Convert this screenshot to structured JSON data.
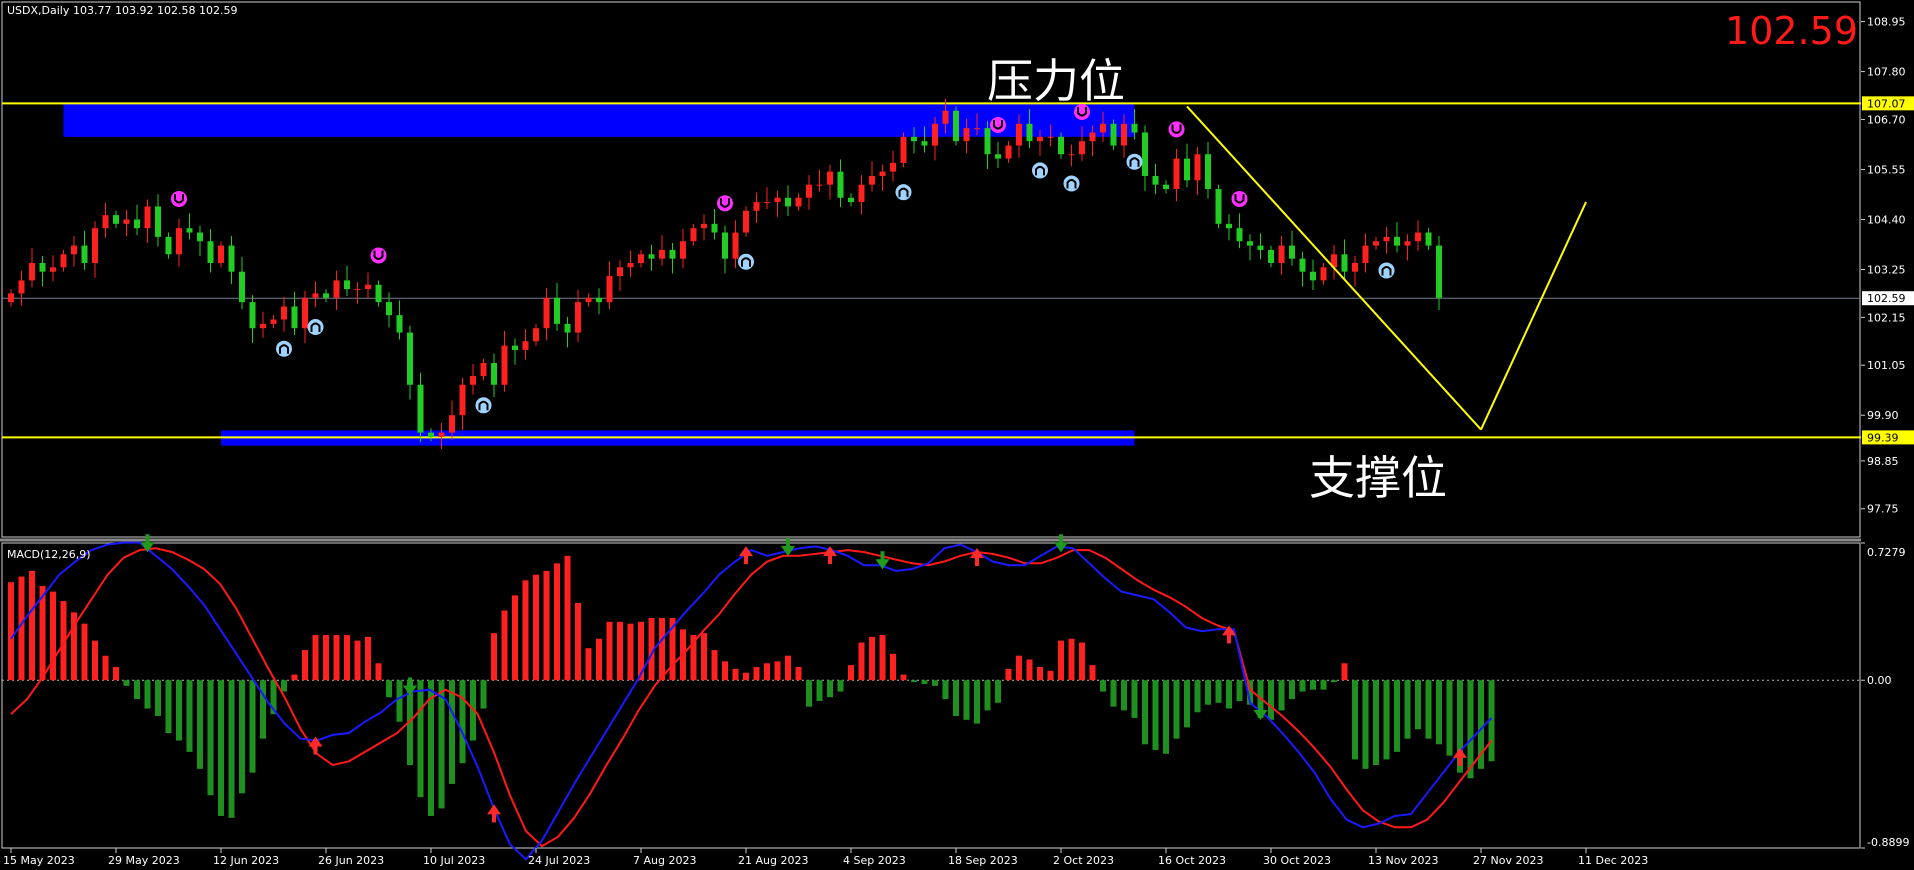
{
  "header": {
    "symbol": "USDX,Daily",
    "ohlc": "103.77 103.92 102.58 102.59",
    "last_price": "102.59"
  },
  "colors": {
    "background": "#000000",
    "bull": "#ff2020",
    "bear": "#22cc22",
    "level_line": "#ffff00",
    "zone": "#0000ff",
    "macd_line": "#1a1aff",
    "signal_line": "#ff1a1a",
    "hist_pos": "#ff2020",
    "hist_neg": "#1f8f1f",
    "up_arrow": "#9fd3ff",
    "down_arrow": "#ff30ff"
  },
  "annotations": {
    "resistance_label": "压力位",
    "support_label": "支撑位"
  },
  "chart_data": [
    {
      "type": "candlestick",
      "title": "USDX,Daily",
      "ylim": [
        97.1,
        109.4
      ],
      "y_ticks": [
        "108.95",
        "107.80",
        "106.70",
        "105.55",
        "104.40",
        "103.25",
        "102.15",
        "101.05",
        "99.90",
        "98.85",
        "97.75"
      ],
      "y_tick_values": [
        108.95,
        107.8,
        106.7,
        105.55,
        104.4,
        103.25,
        102.15,
        101.05,
        99.9,
        98.85,
        97.75
      ],
      "x_ticks": [
        "15 May 2023",
        "29 May 2023",
        "12 Jun 2023",
        "26 Jun 2023",
        "10 Jul 2023",
        "24 Jul 2023",
        "7 Aug 2023",
        "21 Aug 2023",
        "4 Sep 2023",
        "18 Sep 2023",
        "2 Oct 2023",
        "16 Oct 2023",
        "30 Oct 2023",
        "13 Nov 2023",
        "27 Nov 2023",
        "11 Dec 2023"
      ],
      "close": [
        102.7,
        103.0,
        103.4,
        103.2,
        103.3,
        103.6,
        103.8,
        103.4,
        104.2,
        104.5,
        104.3,
        104.4,
        104.2,
        104.7,
        104.0,
        103.6,
        104.2,
        104.1,
        103.9,
        103.4,
        103.8,
        103.2,
        102.5,
        101.9,
        102.0,
        102.1,
        102.4,
        101.9,
        102.6,
        102.7,
        102.6,
        103.0,
        102.8,
        102.8,
        102.9,
        102.5,
        102.2,
        101.8,
        100.6,
        99.5,
        99.4,
        99.5,
        99.9,
        100.6,
        100.8,
        101.1,
        100.6,
        101.5,
        101.4,
        101.6,
        101.9,
        102.6,
        102.0,
        101.8,
        102.5,
        102.6,
        102.5,
        103.1,
        103.3,
        103.4,
        103.6,
        103.5,
        103.7,
        103.5,
        103.9,
        104.2,
        104.3,
        104.1,
        103.5,
        104.1,
        104.6,
        104.8,
        104.8,
        104.9,
        104.7,
        104.9,
        105.2,
        105.2,
        105.5,
        104.9,
        104.8,
        105.2,
        105.4,
        105.5,
        105.7,
        106.3,
        106.2,
        106.1,
        106.6,
        106.9,
        106.2,
        106.5,
        106.5,
        105.9,
        105.8,
        106.1,
        106.6,
        106.2,
        106.3,
        106.3,
        105.9,
        105.9,
        106.2,
        106.4,
        106.6,
        106.1,
        106.6,
        106.4,
        105.4,
        105.2,
        105.1,
        105.8,
        105.3,
        105.9,
        105.1,
        104.3,
        104.2,
        103.9,
        103.8,
        103.7,
        103.4,
        103.8,
        103.5,
        103.2,
        103.0,
        103.3,
        103.6,
        103.2,
        103.4,
        103.8,
        103.9,
        104.0,
        103.8,
        103.9,
        104.1,
        103.8,
        102.6
      ],
      "resistance_level": 107.07,
      "support_level": 99.39,
      "resistance_zone": [
        106.3,
        107.07
      ],
      "support_zone": [
        99.2,
        99.55
      ],
      "projection_line": [
        {
          "bar": 140,
          "price": 99.57
        },
        {
          "bar": 150,
          "price": 104.8
        }
      ],
      "trend_line": [
        {
          "bar": 112,
          "price": 107.0
        },
        {
          "bar": 140,
          "price": 99.57
        }
      ],
      "buy_signals": [
        26,
        29,
        45,
        70,
        85,
        98,
        101,
        107,
        131
      ],
      "sell_signals": [
        16,
        35,
        68,
        94,
        102,
        111,
        117
      ],
      "current_price": 102.59
    },
    {
      "type": "macd",
      "title": "MACD(12,26,9)",
      "ylim": [
        -0.8899,
        0.7279
      ],
      "y_ticks": [
        "0.7279",
        "0.00",
        "-0.8899"
      ],
      "y_tick_values": [
        0.7279,
        0.0,
        -0.8899
      ],
      "histogram": [
        0.52,
        0.55,
        0.58,
        0.5,
        0.47,
        0.42,
        0.36,
        0.3,
        0.21,
        0.13,
        0.07,
        -0.03,
        -0.1,
        -0.15,
        -0.19,
        -0.28,
        -0.32,
        -0.38,
        -0.47,
        -0.61,
        -0.72,
        -0.73,
        -0.6,
        -0.49,
        -0.31,
        -0.18,
        -0.06,
        0.03,
        0.16,
        0.24,
        0.24,
        0.24,
        0.24,
        0.21,
        0.23,
        0.09,
        -0.09,
        -0.22,
        -0.45,
        -0.62,
        -0.72,
        -0.68,
        -0.55,
        -0.44,
        -0.32,
        -0.15,
        0.25,
        0.37,
        0.45,
        0.53,
        0.56,
        0.58,
        0.62,
        0.66,
        0.41,
        0.17,
        0.22,
        0.31,
        0.31,
        0.3,
        0.31,
        0.33,
        0.33,
        0.33,
        0.27,
        0.24,
        0.25,
        0.16,
        0.1,
        0.06,
        0.04,
        0.07,
        0.09,
        0.1,
        0.13,
        0.07,
        -0.14,
        -0.11,
        -0.09,
        -0.06,
        0.08,
        0.2,
        0.23,
        0.24,
        0.14,
        0.03,
        -0.01,
        -0.02,
        -0.03,
        -0.1,
        -0.19,
        -0.21,
        -0.23,
        -0.16,
        -0.12,
        0.06,
        0.13,
        0.11,
        0.07,
        0.05,
        0.21,
        0.22,
        0.2,
        0.08,
        -0.06,
        -0.14,
        -0.16,
        -0.2,
        -0.34,
        -0.37,
        -0.39,
        -0.31,
        -0.25,
        -0.17,
        -0.13,
        -0.12,
        -0.15,
        -0.11,
        -0.13,
        -0.2,
        -0.21,
        -0.16,
        -0.1,
        -0.06,
        -0.05,
        -0.05,
        -0.01,
        0.09,
        -0.42,
        -0.47,
        -0.45,
        -0.42,
        -0.38,
        -0.31,
        -0.26,
        -0.31,
        -0.34,
        -0.4,
        -0.49,
        -0.52,
        -0.47,
        -0.43
      ],
      "macd": [
        0.22,
        0.34,
        0.45,
        0.56,
        0.63,
        0.69,
        0.72,
        0.73,
        0.73,
        0.66,
        0.59,
        0.5,
        0.4,
        0.27,
        0.14,
        0.01,
        -0.12,
        -0.23,
        -0.31,
        -0.32,
        -0.29,
        -0.28,
        -0.22,
        -0.17,
        -0.1,
        -0.06,
        -0.05,
        -0.1,
        -0.27,
        -0.46,
        -0.68,
        -0.87,
        -0.95,
        -0.85,
        -0.7,
        -0.55,
        -0.41,
        -0.27,
        -0.13,
        0.01,
        0.17,
        0.27,
        0.37,
        0.46,
        0.56,
        0.63,
        0.69,
        0.66,
        0.68,
        0.7,
        0.71,
        0.69,
        0.66,
        0.61,
        0.61,
        0.58,
        0.59,
        0.62,
        0.7,
        0.72,
        0.68,
        0.63,
        0.61,
        0.61,
        0.66,
        0.71,
        0.7,
        0.62,
        0.54,
        0.47,
        0.45,
        0.43,
        0.36,
        0.28,
        0.26,
        0.27,
        0.27,
        -0.12,
        -0.19,
        -0.28,
        -0.38,
        -0.49,
        -0.63,
        -0.74,
        -0.78,
        -0.76,
        -0.72,
        -0.71,
        -0.6,
        -0.49,
        -0.38,
        -0.29,
        -0.2
      ],
      "signal": [
        -0.18,
        -0.1,
        0.02,
        0.16,
        0.3,
        0.43,
        0.56,
        0.65,
        0.69,
        0.7,
        0.68,
        0.64,
        0.59,
        0.51,
        0.38,
        0.22,
        0.06,
        -0.09,
        -0.26,
        -0.39,
        -0.45,
        -0.43,
        -0.38,
        -0.33,
        -0.28,
        -0.2,
        -0.1,
        -0.05,
        -0.09,
        -0.18,
        -0.38,
        -0.61,
        -0.8,
        -0.88,
        -0.83,
        -0.73,
        -0.6,
        -0.45,
        -0.31,
        -0.16,
        -0.03,
        0.07,
        0.16,
        0.26,
        0.35,
        0.46,
        0.56,
        0.63,
        0.66,
        0.66,
        0.67,
        0.68,
        0.69,
        0.68,
        0.66,
        0.64,
        0.62,
        0.61,
        0.63,
        0.66,
        0.68,
        0.67,
        0.65,
        0.62,
        0.62,
        0.65,
        0.69,
        0.69,
        0.65,
        0.59,
        0.53,
        0.48,
        0.44,
        0.39,
        0.33,
        0.29,
        0.26,
        -0.05,
        -0.12,
        -0.19,
        -0.27,
        -0.36,
        -0.46,
        -0.58,
        -0.69,
        -0.75,
        -0.78,
        -0.78,
        -0.74,
        -0.65,
        -0.54,
        -0.43,
        -0.32
      ],
      "buy_arrows": [
        29,
        46,
        70,
        78,
        92,
        116,
        138
      ],
      "sell_arrows": [
        13,
        38,
        74,
        83,
        100,
        119
      ]
    }
  ]
}
